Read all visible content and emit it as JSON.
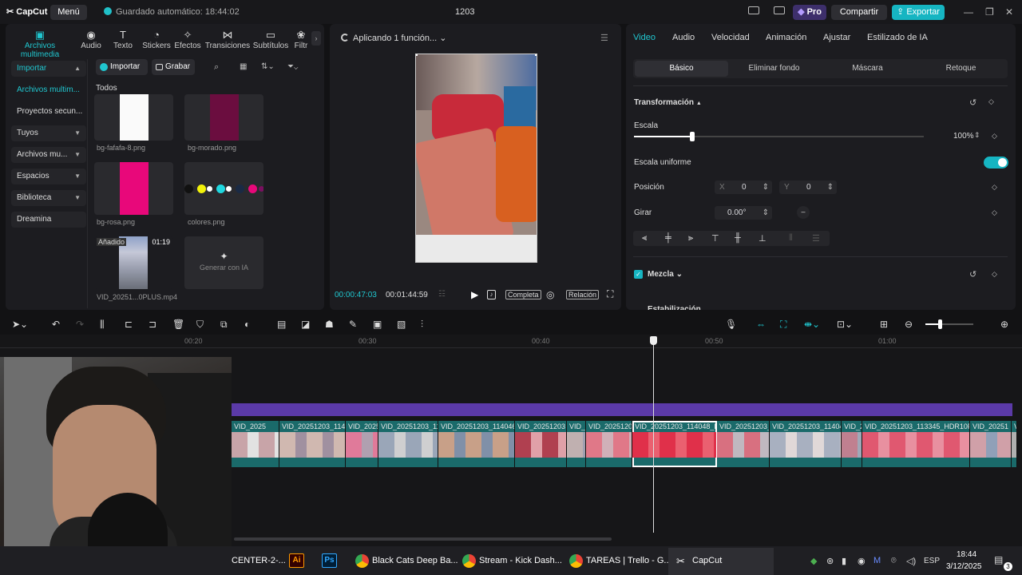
{
  "app": {
    "logo": "CapCut",
    "menu_label": "Menú",
    "autosave": "Guardado automático: 18:44:02",
    "project_title": "1203",
    "pro_label": "Pro",
    "share_label": "Compartir",
    "export_label": "Exportar"
  },
  "left_tools": [
    {
      "label": "Archivos multimedia",
      "icon": "media-icon",
      "active": true
    },
    {
      "label": "Audio",
      "icon": "audio-icon"
    },
    {
      "label": "Texto",
      "icon": "text-icon"
    },
    {
      "label": "Stickers",
      "icon": "sticker-icon"
    },
    {
      "label": "Efectos",
      "icon": "effects-icon"
    },
    {
      "label": "Transiciones",
      "icon": "transitions-icon"
    },
    {
      "label": "Subtítulos",
      "icon": "subtitles-icon"
    },
    {
      "label": "Filtr",
      "icon": "filters-icon"
    }
  ],
  "sidebar": {
    "items": [
      {
        "label": "Importar",
        "chev": "⌃",
        "selected": false
      },
      {
        "label": "Archivos multim...",
        "selected": true
      },
      {
        "label": "Proyectos secun...",
        "selected": false
      },
      {
        "label": "Tuyos",
        "chev": "⌄"
      },
      {
        "label": "Archivos mu...",
        "chev": "⌄"
      },
      {
        "label": "Espacios",
        "chev": "⌄"
      },
      {
        "label": "Biblioteca",
        "chev": "⌄"
      },
      {
        "label": "Dreamina"
      }
    ]
  },
  "media": {
    "import_label": "Importar",
    "record_label": "Grabar",
    "section_label": "Todos",
    "items": [
      {
        "name": "bg-fafafa-8.png",
        "color": "#fafafa"
      },
      {
        "name": "bg-morado.png",
        "color": "#6b0d3f"
      },
      {
        "name": "bg-rosa.png",
        "color": "#e8087a"
      },
      {
        "name": "colores.png",
        "color": "#1a1a1a"
      },
      {
        "name": "VID_20251...0PLUS.mp4",
        "badge": "Añadido",
        "duration": "01:19"
      }
    ],
    "ai_label": "Generar con IA"
  },
  "preview": {
    "status": "Aplicando 1 función...",
    "current_time": "00:00:47:03",
    "total_time": "00:01:44:59",
    "full_label": "Completa",
    "ratio_label": "Relación"
  },
  "inspector": {
    "tabs": [
      "Video",
      "Audio",
      "Velocidad",
      "Animación",
      "Ajustar",
      "Estilizado de IA"
    ],
    "subtabs": [
      "Básico",
      "Eliminar fondo",
      "Máscara",
      "Retoque"
    ],
    "transform_label": "Transformación",
    "scale_label": "Escala",
    "scale_value": "100%",
    "scale_fraction": 0.2,
    "uniform_label": "Escala uniforme",
    "position_label": "Posición",
    "pos_x_label": "X",
    "pos_x": "0",
    "pos_y_label": "Y",
    "pos_y": "0",
    "rotate_label": "Girar",
    "rotate_value": "0.00°",
    "blend_label": "Mezcla",
    "stab_label": "Estabilización"
  },
  "timeline": {
    "ruler": [
      "00:20",
      "00:30",
      "00:40",
      "00:50",
      "01:00"
    ],
    "clips": [
      {
        "label": "VID_2025"
      },
      {
        "label": "VID_20251203_1140"
      },
      {
        "label": "VID_2025"
      },
      {
        "label": "VID_20251203_114"
      },
      {
        "label": "VID_20251203_114046_H"
      },
      {
        "label": "VID_20251203"
      },
      {
        "label": "VID_2"
      },
      {
        "label": "VID_20251203"
      },
      {
        "label": "VID_20251203_114048_HD"
      },
      {
        "label": "VID_20251203_1"
      },
      {
        "label": "VID_20251203_11404"
      },
      {
        "label": "VID_20"
      },
      {
        "label": "VID_20251203_113345_HDR10PLU"
      },
      {
        "label": "VID_20251"
      },
      {
        "label": "V"
      }
    ]
  },
  "taskbar": {
    "items": [
      {
        "label": "CENTER-2-..."
      },
      {
        "label": ""
      },
      {
        "label": ""
      },
      {
        "label": "Black Cats Deep Ba..."
      },
      {
        "label": "Stream - Kick Dash..."
      },
      {
        "label": "TAREAS | Trello - G..."
      },
      {
        "label": "CapCut"
      }
    ],
    "lang": "ESP",
    "time": "18:44",
    "date": "3/12/2025",
    "notif_count": "3"
  }
}
